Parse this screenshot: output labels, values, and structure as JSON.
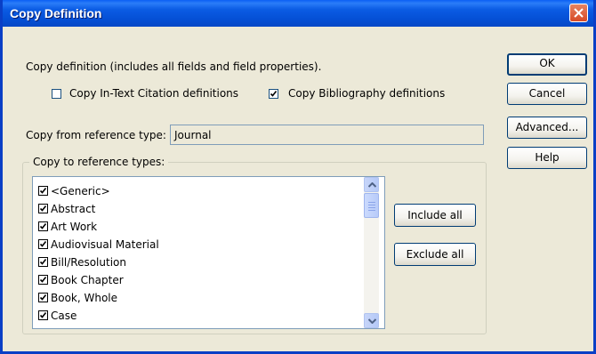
{
  "window": {
    "title": "Copy Definition"
  },
  "description": "Copy definition (includes all fields and field properties).",
  "options": {
    "in_text": {
      "label": "Copy In-Text Citation definitions",
      "checked": false
    },
    "bibliography": {
      "label": "Copy Bibliography definitions",
      "checked": true
    }
  },
  "copy_from": {
    "label": "Copy from reference type:",
    "value": "Journal"
  },
  "copy_to": {
    "label": "Copy to reference types:",
    "items": [
      {
        "label": "<Generic>",
        "checked": true
      },
      {
        "label": "Abstract",
        "checked": true
      },
      {
        "label": "Art Work",
        "checked": true
      },
      {
        "label": "Audiovisual Material",
        "checked": true
      },
      {
        "label": "Bill/Resolution",
        "checked": true
      },
      {
        "label": "Book Chapter",
        "checked": true
      },
      {
        "label": "Book, Whole",
        "checked": true
      },
      {
        "label": "Case",
        "checked": true
      }
    ],
    "include_all": "Include all",
    "exclude_all": "Exclude all"
  },
  "buttons": {
    "ok": "OK",
    "cancel": "Cancel",
    "advanced": "Advanced...",
    "help": "Help"
  },
  "colors": {
    "titlebar": "#0550d6",
    "dialog_bg": "#ece9d8",
    "close": "#d74a26"
  }
}
